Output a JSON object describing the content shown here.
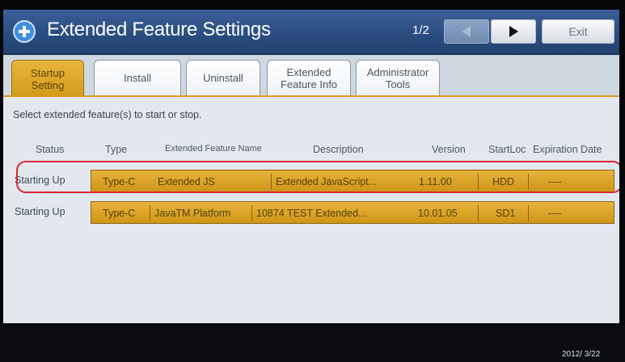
{
  "header": {
    "title": "Extended Feature Settings",
    "page_indicator": "1/2",
    "exit_label": "Exit",
    "app_icon": "plus-gear-icon"
  },
  "tabs": [
    {
      "label": "Startup Setting",
      "active": true
    },
    {
      "label": "Install",
      "active": false
    },
    {
      "label": "Uninstall",
      "active": false
    },
    {
      "label": "Extended Feature Info",
      "active": false
    },
    {
      "label": "Administrator Tools",
      "active": false
    }
  ],
  "instruction": "Select extended feature(s) to start or stop.",
  "table": {
    "columns": [
      "Status",
      "Type",
      "Extended Feature Name",
      "Description",
      "Version",
      "StartLoc",
      "Expiration Date"
    ],
    "rows": [
      {
        "status": "Starting Up",
        "type": "Type-C",
        "name": "Extended JS",
        "description": "Extended JavaScript...",
        "version": "1.11.00",
        "startloc": "HDD",
        "expiration": "----"
      },
      {
        "status": "Starting Up",
        "type": "Type-C",
        "name": "JavaTM Platform",
        "description": "10874 TEST Extended...",
        "version": "10.01.05",
        "startloc": "SD1",
        "expiration": "----"
      }
    ]
  },
  "footer": {
    "date": "2012/ 3/22"
  },
  "colors": {
    "accent": "#d39a1d",
    "title_bar": "#2a4c80",
    "highlight_outline": "#d42a34"
  }
}
